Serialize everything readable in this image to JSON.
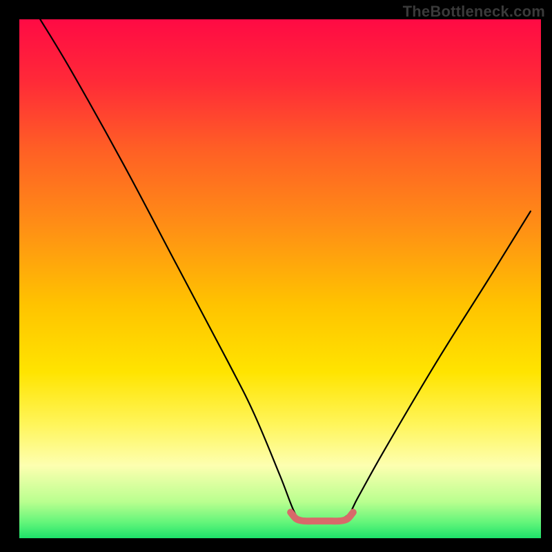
{
  "watermark": "TheBottleneck.com",
  "chart_data": {
    "type": "line",
    "title": "",
    "xlabel": "",
    "ylabel": "",
    "xlim": [
      0,
      100
    ],
    "ylim": [
      0,
      100
    ],
    "series": [
      {
        "name": "bottleneck-curve",
        "x": [
          4,
          10,
          20,
          30,
          40,
          45,
          50,
          53,
          55,
          57,
          60,
          63,
          65,
          70,
          80,
          90,
          98
        ],
        "y": [
          100,
          90,
          72,
          53,
          34,
          24,
          12,
          4.5,
          3.3,
          3.3,
          3.3,
          4.5,
          8,
          17,
          34,
          50,
          63
        ]
      },
      {
        "name": "optimal-zone-marker",
        "x": [
          52,
          53,
          54,
          55,
          56,
          57,
          58,
          59,
          60,
          61,
          62,
          63,
          64
        ],
        "y": [
          5.0,
          3.8,
          3.4,
          3.3,
          3.3,
          3.3,
          3.3,
          3.3,
          3.3,
          3.3,
          3.4,
          3.8,
          5.0
        ]
      }
    ],
    "gradient_bands": [
      {
        "y_pct": 0,
        "color": "#ff0a44"
      },
      {
        "y_pct": 12,
        "color": "#ff2a38"
      },
      {
        "y_pct": 25,
        "color": "#ff5f25"
      },
      {
        "y_pct": 40,
        "color": "#ff8f15"
      },
      {
        "y_pct": 55,
        "color": "#ffc300"
      },
      {
        "y_pct": 68,
        "color": "#ffe400"
      },
      {
        "y_pct": 78,
        "color": "#fff55a"
      },
      {
        "y_pct": 86,
        "color": "#fdffb0"
      },
      {
        "y_pct": 93,
        "color": "#b9ff8f"
      },
      {
        "y_pct": 97,
        "color": "#62f57a"
      },
      {
        "y_pct": 100,
        "color": "#1de26a"
      }
    ],
    "frame": {
      "left_pct": 3.5,
      "right_pct": 98,
      "top_pct": 3.5,
      "bottom_pct": 97.5
    },
    "grid": false,
    "legend": false
  }
}
